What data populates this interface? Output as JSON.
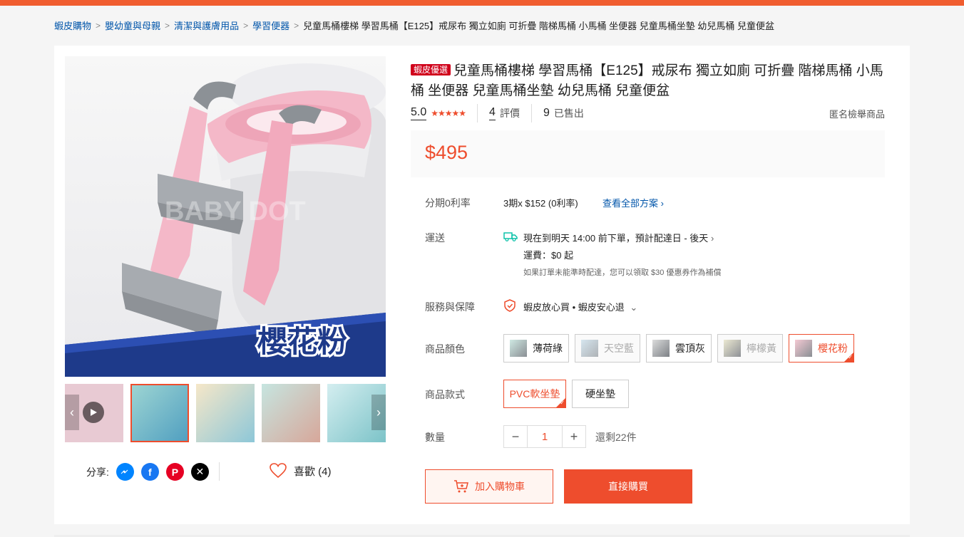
{
  "breadcrumb": {
    "items": [
      "蝦皮購物",
      "嬰幼童與母親",
      "清潔與護膚用品",
      "學習便器"
    ],
    "current": "兒童馬桶樓梯 學習馬桶【E125】戒尿布 獨立如廁 可折疊 階梯馬桶 小馬桶 坐便器 兒童馬桶坐墊 幼兒馬桶 兒童便盆"
  },
  "gallery": {
    "main_image_caption": "櫻花粉",
    "watermark": "BABY DOT"
  },
  "share": {
    "label": "分享:"
  },
  "like": {
    "label": "喜歡 (4)"
  },
  "product": {
    "badge": "蝦皮優選",
    "title": "兒童馬桶樓梯 學習馬桶【E125】戒尿布 獨立如廁 可折疊 階梯馬桶 小馬桶 坐便器 兒童馬桶坐墊 幼兒馬桶 兒童便盆",
    "rating": "5.0",
    "reviews_count": "4",
    "reviews_label": "評價",
    "sold_count": "9",
    "sold_label": "已售出",
    "report": "匿名檢舉商品",
    "price": "$495"
  },
  "installment": {
    "label": "分期0利率",
    "value": "3期x $152 (0利率)",
    "link": "查看全部方案"
  },
  "shipping": {
    "label": "運送",
    "eta": "現在到明天 14:00 前下單，預計配達日 - 後天",
    "fee": "運費：$0 起",
    "note": "如果訂單未能準時配達，您可以領取 $30 優惠券作為補償"
  },
  "guarantee": {
    "label": "服務與保障",
    "value": "蝦皮放心買 • 蝦皮安心退"
  },
  "color": {
    "label": "商品顏色",
    "options": [
      "薄荷綠",
      "天空藍",
      "雲頂灰",
      "檸檬黃",
      "櫻花粉"
    ]
  },
  "style": {
    "label": "商品款式",
    "options": [
      "PVC軟坐墊",
      "硬坐墊"
    ]
  },
  "quantity": {
    "label": "數量",
    "value": "1",
    "stock": "還剩22件"
  },
  "actions": {
    "add_to_cart": "加入購物車",
    "buy_now": "直接購買"
  },
  "colors": {
    "accent": "#ee4d2d",
    "link": "#0055aa",
    "badge": "#d0011b"
  }
}
